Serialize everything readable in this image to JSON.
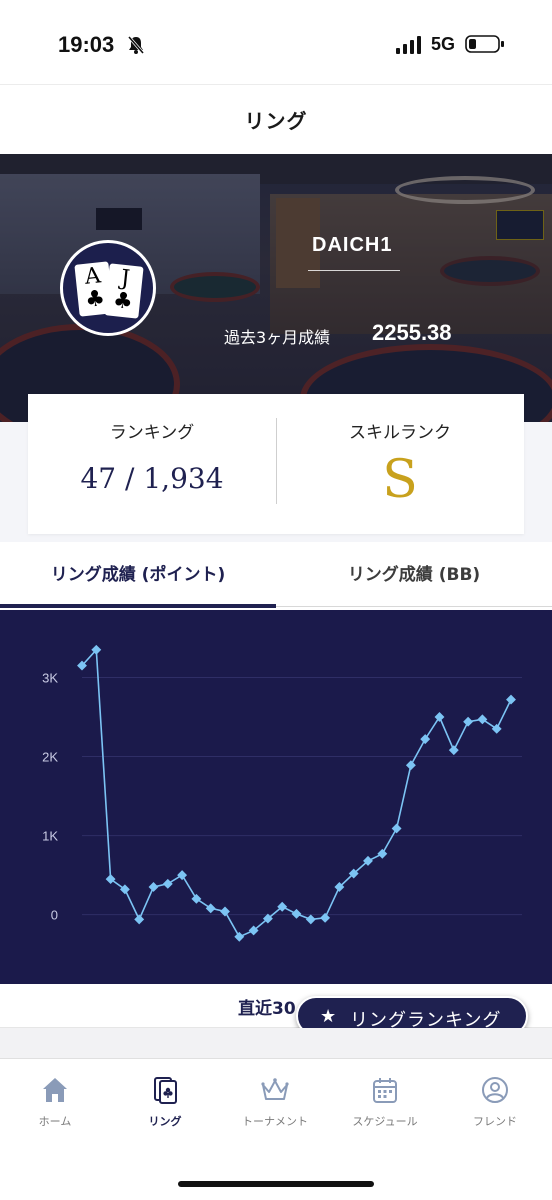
{
  "status_bar": {
    "time": "19:03",
    "network": "5G",
    "icons": [
      "bell-slash-icon",
      "signal-icon",
      "battery-icon"
    ]
  },
  "header": {
    "title": "リング"
  },
  "hero": {
    "player_name": "DAICH1",
    "avatar": {
      "card1_rank": "A",
      "card1_suit": "♣",
      "card2_rank": "J",
      "card2_suit": "♣"
    },
    "performance_label": "過去3ヶ月成績",
    "performance_value": "2255.38"
  },
  "stats": {
    "ranking_label": "ランキング",
    "ranking_value": "47 / 1,934",
    "skill_label": "スキルランク",
    "skill_value": "S",
    "skill_color": "#c8a11d"
  },
  "tabs": [
    {
      "label": "リング成績 (ポイント)",
      "active": true
    },
    {
      "label": "リング成績 (BB)",
      "active": false
    }
  ],
  "chart_data": {
    "type": "line",
    "title": "",
    "xlabel": "",
    "ylabel": "",
    "ylim": [
      -700,
      3600
    ],
    "yticks": [
      0,
      1000,
      2000,
      3000
    ],
    "ytick_labels": [
      "0",
      "1K",
      "2K",
      "3K"
    ],
    "grid": true,
    "line_color": "#7cc4f4",
    "background": "#1b1a4b",
    "series": [
      {
        "values": [
          3150,
          3350,
          450,
          320,
          -60,
          350,
          390,
          500,
          200,
          80,
          40,
          -280,
          -200,
          -50,
          100,
          10,
          -60,
          -40,
          350,
          520,
          680,
          770,
          1090,
          1890,
          2220,
          2500,
          2080,
          2440,
          2470,
          2350,
          2720
        ]
      }
    ]
  },
  "recent": {
    "label": "直近30"
  },
  "ranking_button": {
    "label": "リングランキング",
    "icon": "star-icon"
  },
  "nav": [
    {
      "label": "ホーム",
      "icon": "home-icon",
      "active": false
    },
    {
      "label": "リング",
      "icon": "card-icon",
      "active": true
    },
    {
      "label": "トーナメント",
      "icon": "crown-icon",
      "active": false
    },
    {
      "label": "スケジュール",
      "icon": "calendar-icon",
      "active": false
    },
    {
      "label": "フレンド",
      "icon": "person-icon",
      "active": false
    }
  ],
  "colors": {
    "primary": "#1f2150",
    "accent_gold": "#c8a11d",
    "chart_line": "#7cc4f4"
  }
}
